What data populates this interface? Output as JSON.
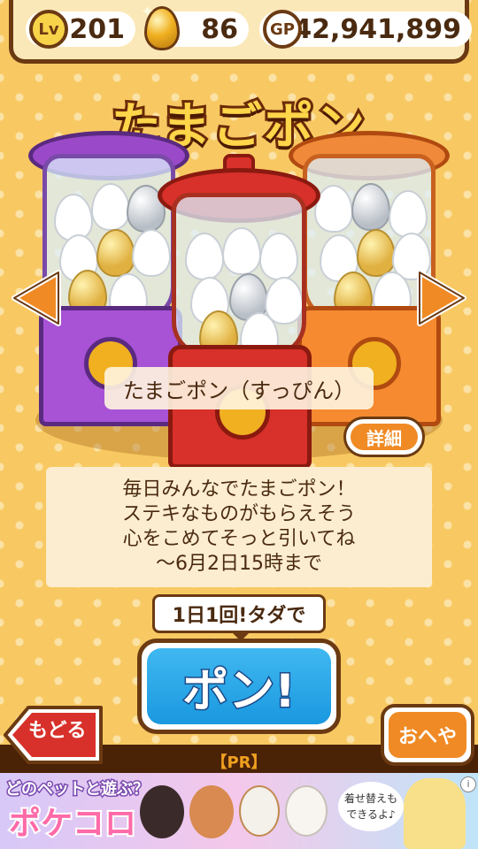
{
  "header": {
    "level_badge": "Lv",
    "level": "201",
    "gold_eggs": "86",
    "gp_badge": "GP",
    "gp": "42,941,899"
  },
  "title": "たまごポン",
  "machine_name": "たまごポン（すっぴん）",
  "detail_button": "詳細",
  "description": [
    "毎日みんなでたまごポン！",
    "ステキなものがもらえそう",
    "心をこめてそっと引いてね",
    "〜6月2日15時まで"
  ],
  "tooltip": "1日1回!タダで",
  "pon_button": "ポン!",
  "back_button": "もどる",
  "room_button": "おへや",
  "pr_label": "【PR】",
  "ad": {
    "headline": "どのペットと遊ぶ？",
    "logo": "ポケコロ",
    "bubble": "着せ替えも できるよ♪",
    "info": "i"
  },
  "colors": {
    "purple": "#a05ad0",
    "red": "#d8302a",
    "orange": "#f08a24",
    "brown": "#6b3a12",
    "blue": "#1a98e0"
  }
}
